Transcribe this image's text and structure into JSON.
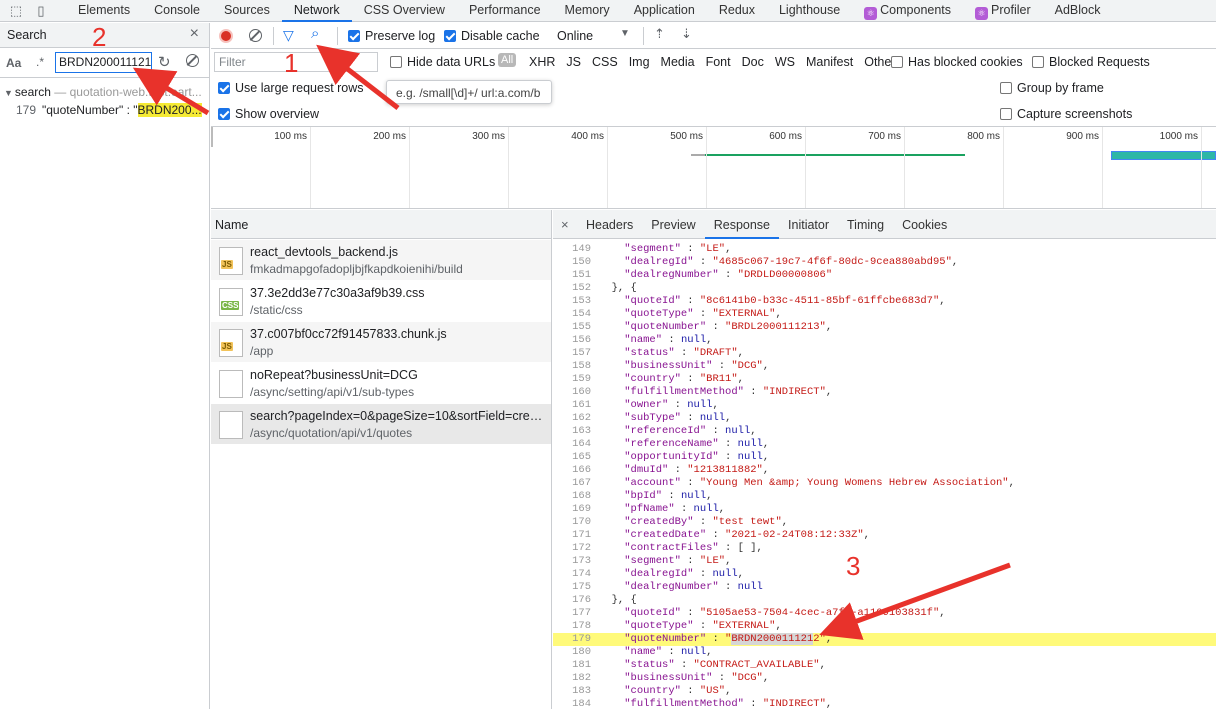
{
  "toolbar_tabs": [
    {
      "label": "Elements",
      "active": false,
      "icon": ""
    },
    {
      "label": "Console",
      "active": false,
      "icon": ""
    },
    {
      "label": "Sources",
      "active": false,
      "icon": ""
    },
    {
      "label": "Network",
      "active": true,
      "icon": ""
    },
    {
      "label": "CSS Overview",
      "active": false,
      "icon": ""
    },
    {
      "label": "Performance",
      "active": false,
      "icon": ""
    },
    {
      "label": "Memory",
      "active": false,
      "icon": ""
    },
    {
      "label": "Application",
      "active": false,
      "icon": ""
    },
    {
      "label": "Redux",
      "active": false,
      "icon": ""
    },
    {
      "label": "Lighthouse",
      "active": false,
      "icon": ""
    },
    {
      "label": "Components",
      "active": false,
      "icon": "react-icon"
    },
    {
      "label": "Profiler",
      "active": false,
      "icon": "react-icon"
    },
    {
      "label": "AdBlock",
      "active": false,
      "icon": ""
    }
  ],
  "search_panel": {
    "title": "Search",
    "case_label": "Aa",
    "regex_label": ".*",
    "query": "BRDN200011121",
    "result_file": "search",
    "result_file_sub": "— quotation-web.test.eart...",
    "result_line_no": "179",
    "result_line_prefix": "\"quoteNumber\" : \"",
    "result_line_match": "BRDN200..."
  },
  "network_toolbar": {
    "preserve_log": "Preserve log",
    "disable_cache": "Disable cache",
    "throttle": "Online",
    "filter_placeholder": "Filter",
    "hide_data_urls": "Hide data URLs",
    "all": "All",
    "types": [
      "XHR",
      "JS",
      "CSS",
      "Img",
      "Media",
      "Font",
      "Doc",
      "WS",
      "Manifest",
      "Other"
    ],
    "has_blocked_cookies": "Has blocked cookies",
    "blocked_requests": "Blocked Requests",
    "large_rows": "Use large request rows",
    "show_overview": "Show overview",
    "group_by_frame": "Group by frame",
    "capture_screenshots": "Capture screenshots",
    "tooltip": "e.g. /small[\\d]+/ url:a.com/b"
  },
  "overview": {
    "ticks": [
      "100 ms",
      "200 ms",
      "300 ms",
      "400 ms",
      "500 ms",
      "600 ms",
      "700 ms",
      "800 ms",
      "900 ms",
      "1000 ms"
    ],
    "colors": {
      "green": "#1aa260",
      "teal": "#2db7a6",
      "blue": "#4285f4"
    }
  },
  "requests": {
    "header": "Name",
    "items": [
      {
        "name": "react_devtools_backend.js",
        "path": "fmkadmapgofadopljbjfkapdkoienihi/build",
        "type": "js"
      },
      {
        "name": "37.3e2dd3e77c30a3af9b39.css",
        "path": "/static/css",
        "type": "css"
      },
      {
        "name": "37.c007bf0cc72f91457833.chunk.js",
        "path": "/app",
        "type": "js"
      },
      {
        "name": "noRepeat?businessUnit=DCG",
        "path": "/async/setting/api/v1/sub-types",
        "type": "doc"
      },
      {
        "name": "search?pageIndex=0&pageSize=10&sortField=create...",
        "path": "/async/quotation/api/v1/quotes",
        "type": "doc"
      }
    ]
  },
  "response_panel": {
    "close": "×",
    "tabs": [
      "Headers",
      "Preview",
      "Response",
      "Initiator",
      "Timing",
      "Cookies"
    ],
    "active_tab": "Response",
    "lines": [
      {
        "n": "149",
        "t": "    \"segment\" : \"LE\","
      },
      {
        "n": "150",
        "t": "    \"dealregId\" : \"4685c067-19c7-4f6f-80dc-9cea880abd95\","
      },
      {
        "n": "151",
        "t": "    \"dealregNumber\" : \"DRDLD00000806\""
      },
      {
        "n": "152",
        "t": "  }, {"
      },
      {
        "n": "153",
        "t": "    \"quoteId\" : \"8c6141b0-b33c-4511-85bf-61ffcbe683d7\","
      },
      {
        "n": "154",
        "t": "    \"quoteType\" : \"EXTERNAL\","
      },
      {
        "n": "155",
        "t": "    \"quoteNumber\" : \"BRDL2000111213\","
      },
      {
        "n": "156",
        "t": "    \"name\" : null,"
      },
      {
        "n": "157",
        "t": "    \"status\" : \"DRAFT\","
      },
      {
        "n": "158",
        "t": "    \"businessUnit\" : \"DCG\","
      },
      {
        "n": "159",
        "t": "    \"country\" : \"BR11\","
      },
      {
        "n": "160",
        "t": "    \"fulfillmentMethod\" : \"INDIRECT\","
      },
      {
        "n": "161",
        "t": "    \"owner\" : null,"
      },
      {
        "n": "162",
        "t": "    \"subType\" : null,"
      },
      {
        "n": "163",
        "t": "    \"referenceId\" : null,"
      },
      {
        "n": "164",
        "t": "    \"referenceName\" : null,"
      },
      {
        "n": "165",
        "t": "    \"opportunityId\" : null,"
      },
      {
        "n": "166",
        "t": "    \"dmuId\" : \"1213811882\","
      },
      {
        "n": "167",
        "t": "    \"account\" : \"Young Men & Young Womens Hebrew Association\","
      },
      {
        "n": "168",
        "t": "    \"bpId\" : null,"
      },
      {
        "n": "169",
        "t": "    \"pfName\" : null,"
      },
      {
        "n": "170",
        "t": "    \"createdBy\" : \"test tewt\","
      },
      {
        "n": "171",
        "t": "    \"createdDate\" : \"2021-02-24T08:12:33Z\","
      },
      {
        "n": "172",
        "t": "    \"contractFiles\" : [ ],"
      },
      {
        "n": "173",
        "t": "    \"segment\" : \"LE\","
      },
      {
        "n": "174",
        "t": "    \"dealregId\" : null,"
      },
      {
        "n": "175",
        "t": "    \"dealregNumber\" : null"
      },
      {
        "n": "176",
        "t": "  }, {"
      },
      {
        "n": "177",
        "t": "    \"quoteId\" : \"5105ae53-7504-4cec-a7ff-a1109103831f\","
      },
      {
        "n": "178",
        "t": "    \"quoteType\" : \"EXTERNAL\","
      },
      {
        "n": "179",
        "t": "    \"quoteNumber\" : \"BRDN2000111212\",",
        "highlight": true,
        "match": "BRDN200011121"
      },
      {
        "n": "180",
        "t": "    \"name\" : null,"
      },
      {
        "n": "181",
        "t": "    \"status\" : \"CONTRACT_AVAILABLE\","
      },
      {
        "n": "182",
        "t": "    \"businessUnit\" : \"DCG\","
      },
      {
        "n": "183",
        "t": "    \"country\" : \"US\","
      },
      {
        "n": "184",
        "t": "    \"fulfillmentMethod\" : \"INDIRECT\","
      }
    ]
  },
  "annotations": {
    "one": "1",
    "two": "2",
    "three": "3",
    "color": "#e8322b"
  }
}
